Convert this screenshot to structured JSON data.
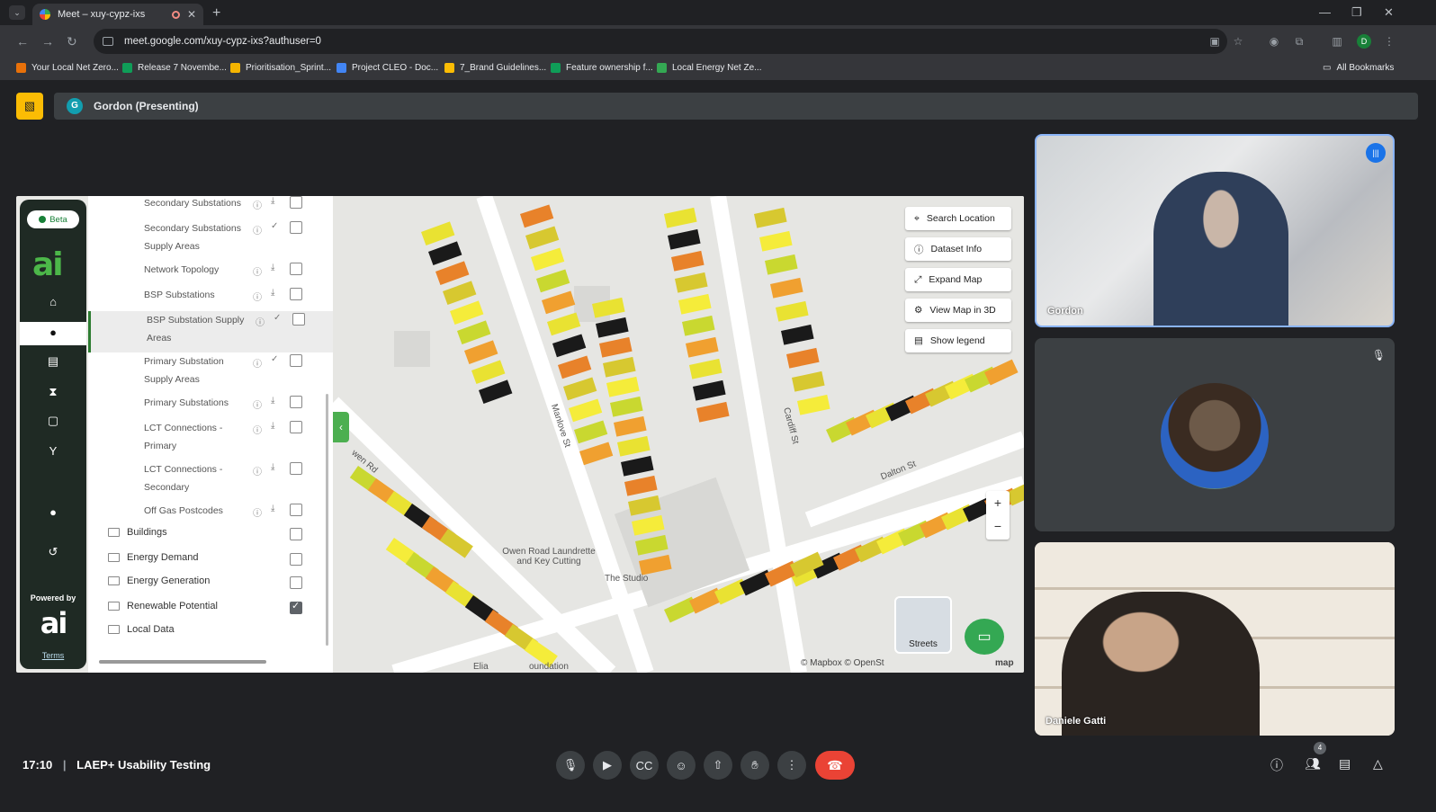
{
  "browser": {
    "tab_title": "Meet – xuy-cypz-ixs",
    "tab_close": "✕",
    "new_tab": "+",
    "url": "meet.google.com/xuy-cypz-ixs?authuser=0",
    "profile_initial": "D",
    "bookmarks": [
      {
        "label": "Your Local Net Zero...",
        "color": "#e8710a"
      },
      {
        "label": "Release 7 Novembe...",
        "color": "#0f9d58"
      },
      {
        "label": "Prioritisation_Sprint...",
        "color": "#f4b400"
      },
      {
        "label": "Project CLEO - Doc...",
        "color": "#4285f4"
      },
      {
        "label": "7_Brand Guidelines...",
        "color": "#fbbc04"
      },
      {
        "label": "Feature ownership f...",
        "color": "#0f9d58"
      },
      {
        "label": "Local Energy Net Ze...",
        "color": "#34a853"
      }
    ],
    "all_bookmarks": "All Bookmarks"
  },
  "meet": {
    "presenter_initial": "G",
    "presenter_label": "Gordon (Presenting)",
    "time": "17:10",
    "meeting_name": "LAEP+ Usability Testing",
    "participant_count": "4",
    "tiles": [
      {
        "name": "Gordon"
      },
      {
        "name": ""
      },
      {
        "name": "Daniele Gatti"
      }
    ]
  },
  "app": {
    "beta": "Beta",
    "logo": "ai",
    "powered_by": "Powered by",
    "logo2": "ai",
    "terms": "Terms",
    "layers": [
      {
        "name": "Secondary Substations",
        "checked": false
      },
      {
        "name": "Secondary Substations Supply Areas",
        "checked": false
      },
      {
        "name": "Network Topology",
        "checked": false
      },
      {
        "name": "BSP Substations",
        "checked": false
      },
      {
        "name": "BSP Substation Supply Areas",
        "checked": false
      },
      {
        "name": "Primary Substation Supply Areas",
        "checked": false
      },
      {
        "name": "Primary Substations",
        "checked": false
      },
      {
        "name": "LCT Connections - Primary",
        "checked": false
      },
      {
        "name": "LCT Connections - Secondary",
        "checked": false
      },
      {
        "name": "Off Gas Postcodes",
        "checked": false
      }
    ],
    "folders": [
      {
        "name": "Buildings",
        "checked": false
      },
      {
        "name": "Energy Demand",
        "checked": false
      },
      {
        "name": "Energy Generation",
        "checked": false
      },
      {
        "name": "Renewable Potential",
        "checked": true
      },
      {
        "name": "Local Data",
        "checked": null
      }
    ],
    "map_buttons": [
      "Search Location",
      "Dataset Info",
      "Expand Map",
      "View Map in 3D",
      "Show legend"
    ],
    "map_labels": {
      "street1": "Manlove St",
      "street2": "Cardiff St",
      "street3": "Dalton St",
      "street4": "wen Rd",
      "poi1": "Owen Road Laundrette and Key Cutting",
      "poi2": "The Studio",
      "poi3": "Elia",
      "poi4": "oundation",
      "streets": "Streets",
      "attribution": "© Mapbox © OpenSt",
      "attribution2": "map",
      "zoom_in": "+",
      "zoom_out": "−"
    }
  }
}
